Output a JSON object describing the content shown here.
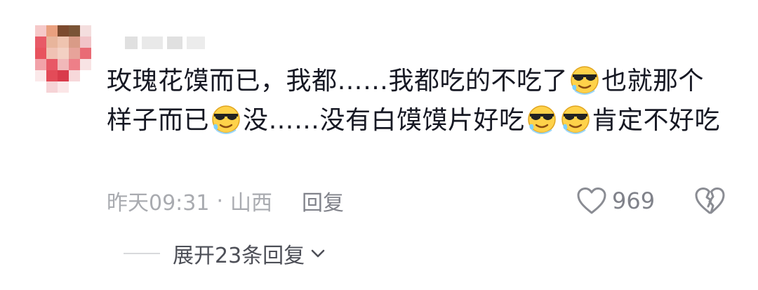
{
  "comment": {
    "segments": [
      "玫瑰花馍而已，我都……我都吃的不吃了",
      "也就那个样子而已",
      "没……没有白馍馍片好吃",
      "肯定不好吃"
    ],
    "emoji_icon": "cool-sunglasses-sweat-emoji"
  },
  "meta": {
    "time": "昨天09:31",
    "separator": "·",
    "location": "山西",
    "reply_label": "回复"
  },
  "actions": {
    "like_count": "969",
    "like_icon": "heart-outline-icon",
    "dislike_icon": "broken-heart-icon"
  },
  "replies": {
    "expand_label": "展开23条回复"
  },
  "colors": {
    "text_primary": "#161823",
    "text_meta": "#a9abb0",
    "text_secondary": "#80828a",
    "emoji_face": "#ffd24a"
  }
}
